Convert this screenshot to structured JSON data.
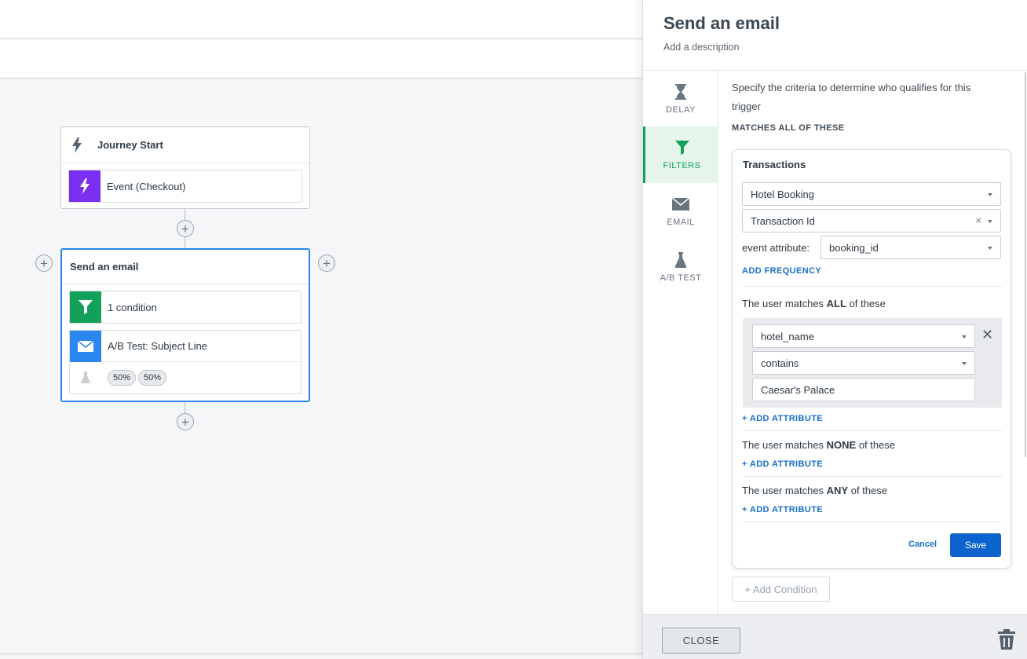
{
  "journey": {
    "start_card": {
      "title": "Journey Start",
      "event_label": "Event (Checkout)"
    },
    "email_card": {
      "title": "Send an email",
      "condition_label": "1 condition",
      "ab_test_label": "A/B Test: Subject Line",
      "splits": [
        "50%",
        "50%"
      ]
    }
  },
  "panel": {
    "title": "Send an email",
    "description": "Add a description",
    "nav": [
      {
        "label": "DELAY",
        "icon": "hourglass-icon"
      },
      {
        "label": "FILTERS",
        "icon": "filter-icon",
        "active": true
      },
      {
        "label": "EMAIL",
        "icon": "envelope-icon"
      },
      {
        "label": "A/B TEST",
        "icon": "flask-icon"
      }
    ],
    "intro": "Specify the criteria to determine who qualifies for this trigger",
    "matches_heading": "MATCHES ALL OF THESE",
    "condition": {
      "title": "Transactions",
      "transaction_type": "Hotel Booking",
      "transaction_field": "Transaction Id",
      "event_attribute_label": "event attribute:",
      "event_attribute_value": "booking_id",
      "add_frequency": "ADD FREQUENCY",
      "all_prefix": "The user matches ",
      "all_word": "ALL",
      "all_suffix": " of these",
      "attr_name": "hotel_name",
      "attr_operator": "contains",
      "attr_value": "Caesar's Palace",
      "add_attribute": "+ ADD ATTRIBUTE",
      "none_prefix": "The user matches ",
      "none_word": "NONE",
      "none_suffix": " of these",
      "any_prefix": "The user matches ",
      "any_word": "ANY",
      "any_suffix": " of these",
      "cancel": "Cancel",
      "save": "Save"
    },
    "add_condition": "+ Add Condition",
    "close": "CLOSE"
  },
  "colors": {
    "accent_green": "#13a05a",
    "accent_purple": "#7b2ff0",
    "accent_blue": "#2b86f0",
    "primary_button": "#0b63ce",
    "link": "#1a6fc9"
  }
}
